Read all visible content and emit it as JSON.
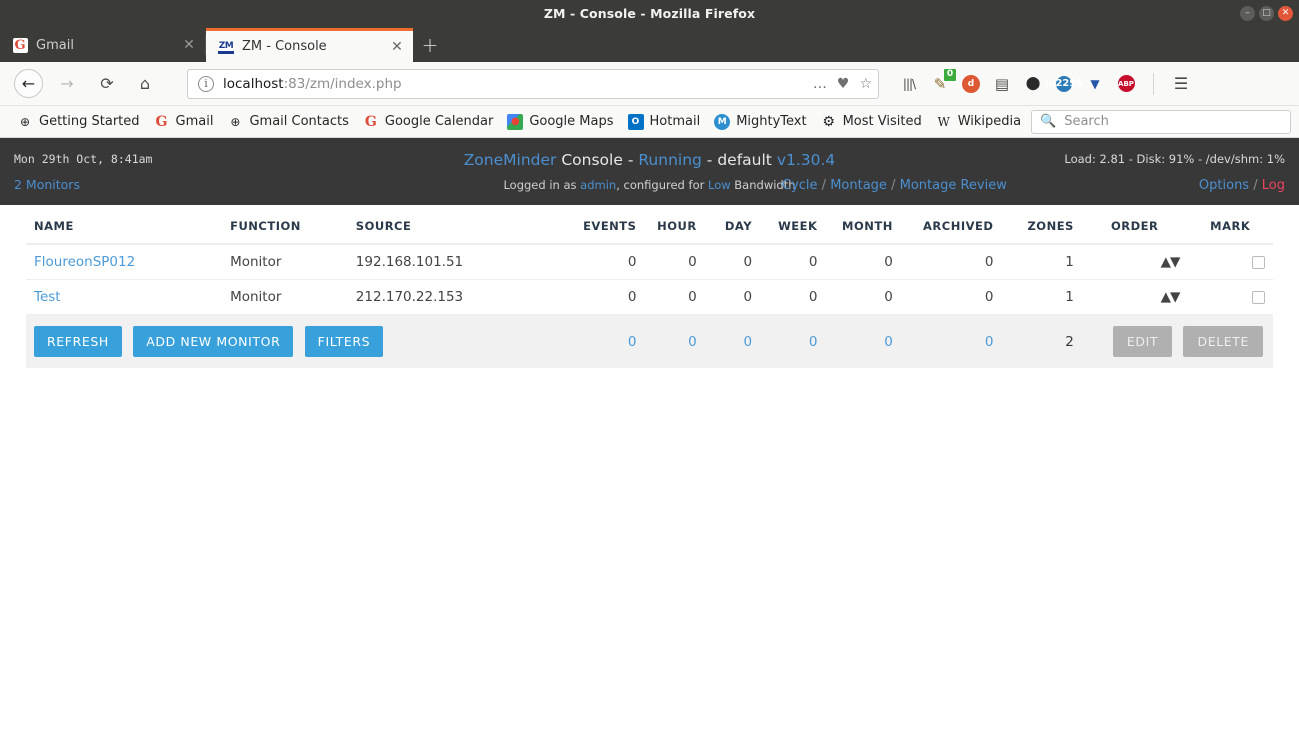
{
  "window": {
    "title": "ZM - Console - Mozilla Firefox",
    "minimize": "–",
    "maximize": "□",
    "close": "✕"
  },
  "tabs": [
    {
      "favicon": "gmail-favicon",
      "favicon_text": "G",
      "title": "Gmail",
      "close": "✕",
      "active": false
    },
    {
      "favicon": "zm-favicon",
      "favicon_text": "ZM",
      "title": "ZM - Console",
      "close": "✕",
      "active": true
    }
  ],
  "newtab_label": "+",
  "nav": {
    "back": "←",
    "forward": "→",
    "reload": "⟳",
    "home": "⌂",
    "url_host": "localhost",
    "url_path": ":83/zm/index.php",
    "url_full": "localhost:83/zm/index.php",
    "page_actions": "…",
    "pocket": "♥",
    "bookmark_star": "☆",
    "info_icon": "i"
  },
  "toolbar_icons": [
    {
      "name": "library-icon",
      "glyph": "|||\\"
    },
    {
      "name": "addon-pen-icon",
      "glyph": "✎",
      "badge": "0"
    },
    {
      "name": "duckduckgo-icon",
      "glyph": "●"
    },
    {
      "name": "reader-sidebar-icon",
      "glyph": "▤"
    },
    {
      "name": "molecule-icon",
      "glyph": "⬤"
    },
    {
      "name": "globe-screen-icon",
      "glyph": "☸"
    },
    {
      "name": "download-helper-icon",
      "glyph": "▼"
    },
    {
      "name": "adblock-plus-icon",
      "glyph": "ABP"
    },
    {
      "name": "hamburger-menu-icon",
      "glyph": "☰"
    }
  ],
  "bookmarks": [
    {
      "icon": "globe-icon",
      "glyph": "⊕",
      "label": "Getting Started"
    },
    {
      "icon": "google-icon",
      "glyph": "G",
      "label": "Gmail"
    },
    {
      "icon": "globe-icon",
      "glyph": "⊕",
      "label": "Gmail Contacts"
    },
    {
      "icon": "google-icon",
      "glyph": "G",
      "label": "Google Calendar"
    },
    {
      "icon": "maps-icon",
      "glyph": "◢",
      "label": "Google Maps"
    },
    {
      "icon": "outlook-icon",
      "glyph": "O",
      "label": "Hotmail"
    },
    {
      "icon": "mightytext-icon",
      "glyph": "M",
      "label": "MightyText"
    },
    {
      "icon": "gear-icon",
      "glyph": "⚙",
      "label": "Most Visited"
    },
    {
      "icon": "wikipedia-icon",
      "glyph": "W",
      "label": "Wikipedia"
    }
  ],
  "bookmark_search": {
    "icon": "search-icon",
    "glyph": "⚲",
    "placeholder": "Search",
    "value": ""
  },
  "zm": {
    "date": "Mon 29th Oct, 8:41am",
    "monitors_link": "2 Monitors",
    "brand": "ZoneMinder",
    "title_console": "Console",
    "title_sep1": "-",
    "status": "Running",
    "title_sep2": "-",
    "server": "default",
    "version": "v1.30.4",
    "logged_in_prefix": "Logged in as",
    "user": "admin",
    "config_prefix": ", configured for",
    "bandwidth": "Low",
    "config_suffix": "Bandwidth",
    "system_stats": "Load: 2.81 - Disk: 91% - /dev/shm: 1%",
    "nav_cycle": "Cycle",
    "nav_montage": "Montage",
    "nav_montage_review": "Montage Review",
    "nav_slash": "/",
    "nav_options": "Options",
    "nav_log": "Log"
  },
  "table": {
    "headers": [
      "NAME",
      "FUNCTION",
      "SOURCE",
      "EVENTS",
      "HOUR",
      "DAY",
      "WEEK",
      "MONTH",
      "ARCHIVED",
      "ZONES",
      "ORDER",
      "MARK"
    ],
    "rows": [
      {
        "name": "FloureonSP012",
        "function": "Monitor",
        "source": "192.168.101.51",
        "events": "0",
        "hour": "0",
        "day": "0",
        "week": "0",
        "month": "0",
        "archived": "0",
        "zones": "1",
        "order": "▲▼",
        "mark": false
      },
      {
        "name": "Test",
        "function": "Monitor",
        "source": "212.170.22.153",
        "events": "0",
        "hour": "0",
        "day": "0",
        "week": "0",
        "month": "0",
        "archived": "0",
        "zones": "1",
        "order": "▲▼",
        "mark": false
      }
    ],
    "totals": {
      "events": "0",
      "hour": "0",
      "day": "0",
      "week": "0",
      "month": "0",
      "archived": "0",
      "zones": "2"
    }
  },
  "buttons": {
    "refresh": "REFRESH",
    "add_new_monitor": "ADD NEW MONITOR",
    "filters": "FILTERS",
    "edit": "EDIT",
    "delete": "DELETE"
  },
  "colors": {
    "accent_blue": "#4b9bd8",
    "link_blue": "#4b8fd0",
    "red_source": "#e0304a",
    "log_red": "#e8445e",
    "olive_function": "#8a8a38",
    "header_dark": "#383838",
    "button_blue": "#38a1db",
    "button_disabled": "#b0b0b0",
    "tab_active_accent": "#ef6c2e"
  }
}
